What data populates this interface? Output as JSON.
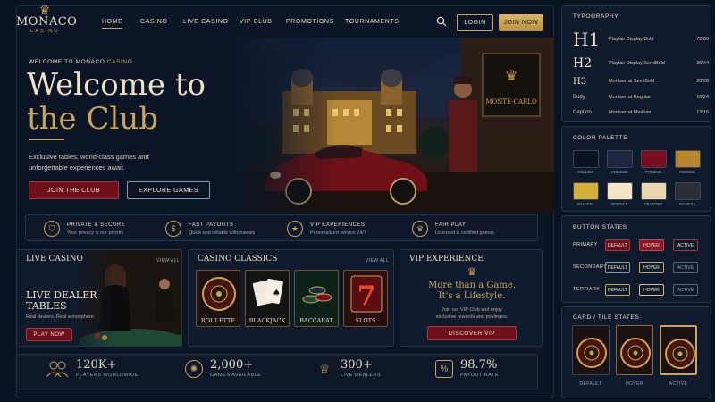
{
  "brand": {
    "name": "MONACO",
    "sub": "CASINO"
  },
  "nav": {
    "items": [
      "HOME",
      "CASINO",
      "LIVE CASINO",
      "VIP CLUB",
      "PROMOTIONS",
      "TOURNAMENTS"
    ],
    "login": "LOGIN",
    "join": "JOIN NOW"
  },
  "hero": {
    "eyebrow_a": "WELCOME TO MONACO ",
    "eyebrow_b": "CASINO",
    "title_line1": "Welcome to",
    "title_line2": "the Club",
    "body": "Exclusive tables, world-class games and unforgettable experiences await.",
    "primary": "JOIN THE CLUB",
    "secondary": "EXPLORE GAMES",
    "sign": "MONTE-CARLO"
  },
  "features": [
    {
      "icon": "shield-icon",
      "title": "PRIVATE & SECURE",
      "sub": "Your privacy is our priority"
    },
    {
      "icon": "money-icon",
      "title": "FAST PAYOUTS",
      "sub": "Quick and reliable withdrawals"
    },
    {
      "icon": "star-icon",
      "title": "VIP EXPERIENCES",
      "sub": "Personalized service 24/7"
    },
    {
      "icon": "crown-icon",
      "title": "FAIR PLAY",
      "sub": "Licensed & certified games"
    }
  ],
  "live": {
    "title": "LIVE CASINO",
    "view": "VIEW ALL",
    "heading_1": "LIVE DEALER",
    "heading_2": "TABLES",
    "sub": "Real dealers. Real atmosphere.",
    "cta": "PLAY NOW"
  },
  "classics": {
    "title": "CASINO CLASSICS",
    "view": "VIEW ALL",
    "games": [
      "ROULETTE",
      "BLACKJACK",
      "BACCARAT",
      "SLOTS"
    ]
  },
  "vip": {
    "title": "VIP EXPERIENCE",
    "line1": "More than a Game.",
    "line2": "It's a Lifestyle.",
    "body1": "Join our VIP Club and enjoy",
    "body2": "exclusive rewards and privileges.",
    "cta": "DISCOVER VIP"
  },
  "stats": [
    {
      "icon": "players-icon",
      "value": "120K+",
      "label": "PLAYERS WORLDWIDE"
    },
    {
      "icon": "chip-icon",
      "value": "2,000+",
      "label": "GAMES AVAILABLE"
    },
    {
      "icon": "trophy-icon",
      "value": "300+",
      "label": "LIVE DEALERS"
    },
    {
      "icon": "shield-percent-icon",
      "value": "98.7%",
      "label": "PAYOUT RATE"
    }
  ],
  "typography": {
    "title": "TYPOGRAPHY",
    "rows": [
      {
        "tag": "H1",
        "font": "Playfair Display Bold",
        "size": "72/80"
      },
      {
        "tag": "H2",
        "font": "Playfair Display SemiBold",
        "size": "36/44"
      },
      {
        "tag": "H3",
        "font": "Montserrat SemiBold",
        "size": "20/28"
      },
      {
        "tag": "Body",
        "font": "Montserrat Regular",
        "size": "16/24"
      },
      {
        "tag": "Caption",
        "font": "Montserrat Medium",
        "size": "12/16"
      }
    ]
  },
  "palette": {
    "title": "COLOR PALETTE",
    "colors": [
      "#0B1323",
      "#1D263E",
      "#7B0E1E",
      "#B88628",
      "#D4AF37",
      "#F5E6C6",
      "#EAD7B0",
      "#2A2F3A"
    ],
    "labels": [
      "#0B1323",
      "#1D263E",
      "#7B0E1E",
      "#B88628",
      "#D4AF37",
      "#F5E6C6",
      "#EAD7B0",
      "#2A2F3A"
    ]
  },
  "button_states": {
    "title": "BUTTON STATES",
    "rows": [
      "PRIMARY",
      "SECONDARY",
      "TERTIARY"
    ],
    "states": [
      "DEFAULT",
      "HOVER",
      "ACTIVE"
    ]
  },
  "tiles": {
    "title": "CARD / TILE STATES",
    "states": [
      "DEFAULT",
      "HOVER",
      "ACTIVE"
    ]
  }
}
